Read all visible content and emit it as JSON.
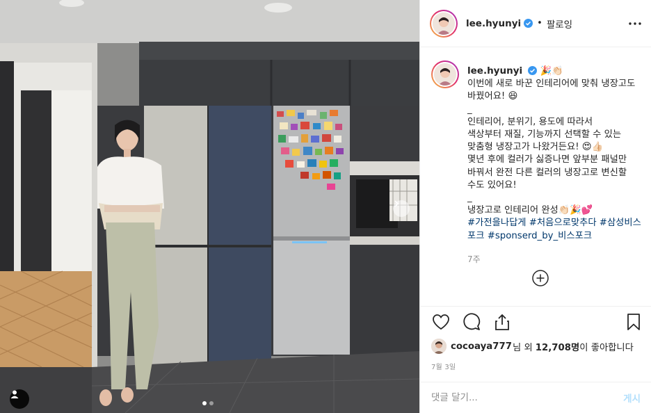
{
  "post": {
    "username": "lee.hyunyi",
    "follow_label": "팔로잉",
    "dot": "•",
    "caption_emoji_head": "🎉👏🏻",
    "caption": "이번에 새로 바꾼 인테리어에 맞춰 냉장고도 바꿨어요! 😆\n_\n인테리어, 분위기, 용도에 따라서\n색상부터 재질, 기능까지 선택할 수 있는\n맞춤형 냉장고가 나왔거든요! 😍👍🏻\n몇년 후에 컬러가 싫증나면 앞부분 패널만 바꿔서 완전 다른 컬러의 냉장고로 변신할 수도 있어요!\n_\n냉장고로 인테리어 완성👏🏻🎉💕",
    "hashtags": [
      "#가전을나답게",
      "#처음으로맞추다",
      "#삼성비스포크",
      "#sponserd_by_비스포크"
    ],
    "time_ago": "7주",
    "likes": {
      "liker": "cocoaya777",
      "liker_suffix": "님 외",
      "count": "12,708명",
      "tail": "이 좋아합니다"
    },
    "date": "7월 3일",
    "comment_placeholder": "댓글 달기...",
    "post_button": "게시"
  },
  "carousel": {
    "slides": 2,
    "active": 1
  },
  "colors": {
    "verified": "#3897f0",
    "hashtag": "#00376b",
    "muted": "#8e8e8e",
    "border": "#efefef",
    "post_button_disabled": "#b2dffc"
  },
  "icons": [
    "more-options-icon",
    "heart-icon",
    "comment-icon",
    "share-icon",
    "bookmark-icon",
    "plus-circle-icon",
    "user-tag-icon",
    "chevron-right-icon",
    "verified-badge-icon"
  ]
}
